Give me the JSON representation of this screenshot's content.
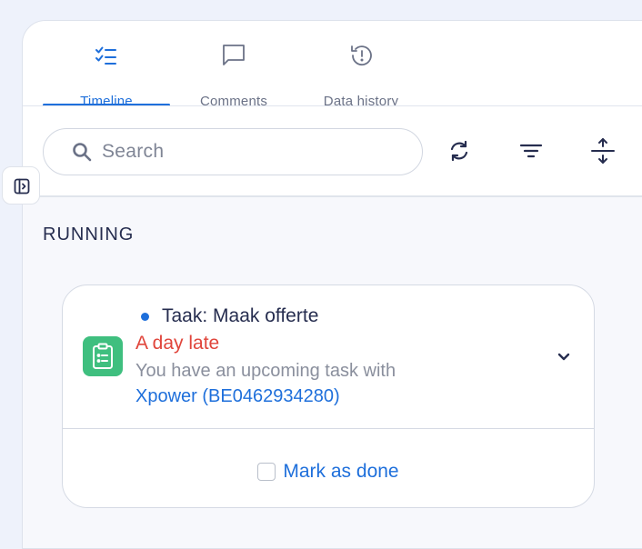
{
  "tabs": [
    {
      "label": "Timeline",
      "icon": "checklist-icon",
      "active": true
    },
    {
      "label": "Comments",
      "icon": "comment-icon",
      "active": false
    },
    {
      "label": "Data history",
      "icon": "history-icon",
      "active": false
    }
  ],
  "search": {
    "placeholder": "Search"
  },
  "toolbar": {
    "icons": [
      "refresh-icon",
      "filter-icon",
      "expand-collapse-icon"
    ]
  },
  "section": {
    "title": "RUNNING"
  },
  "task": {
    "title": "Taak: Maak offerte",
    "status": "A day late",
    "description": "You have an upcoming task with",
    "company": "Xpower (BE0462934280)",
    "mark_done_label": "Mark as done",
    "icon": "clipboard-list-icon"
  },
  "sidebar_toggle": {
    "icon": "sidebar-toggle-icon"
  },
  "colors": {
    "accent": "#1e6fdb",
    "late": "#e0453b",
    "task_icon_bg": "#3fbf7f",
    "page_bg": "#eef2fb"
  }
}
